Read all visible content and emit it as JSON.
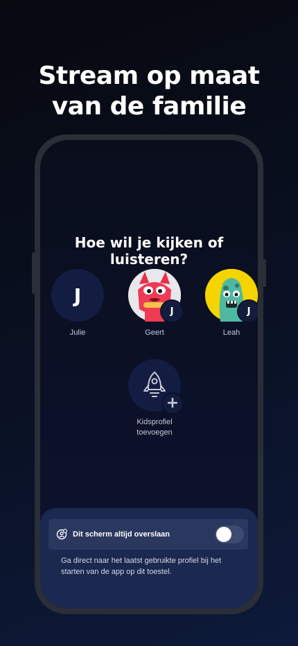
{
  "headline": {
    "line1": "Stream op maat",
    "line2": "van de familie"
  },
  "screen": {
    "question": "Hoe wil je kijken of luisteren?",
    "profiles": [
      {
        "name": "Julie",
        "initial": "J"
      },
      {
        "name": "Geert",
        "badge": "J",
        "avatar_icon": "pink-cat-character-icon"
      },
      {
        "name": "Leah",
        "badge": "J",
        "avatar_icon": "green-monster-character-icon"
      }
    ],
    "add_kids": {
      "line1": "Kidsprofiel",
      "line2": "toevoegen",
      "icon": "rocket-icon",
      "plus": "+"
    },
    "sheet": {
      "skip_label": "Dit scherm altijd overslaan",
      "toggle_on": false,
      "description": "Ga direct naar het laatst gebruikte profiel bij het starten van de app op dit toestel."
    }
  },
  "colors": {
    "background": "#0a1124",
    "avatar_bg": "#131d42",
    "sheet_bg": "#1b2850",
    "cat_bg": "#e8e8ec",
    "monster_bg": "#f5d400"
  }
}
